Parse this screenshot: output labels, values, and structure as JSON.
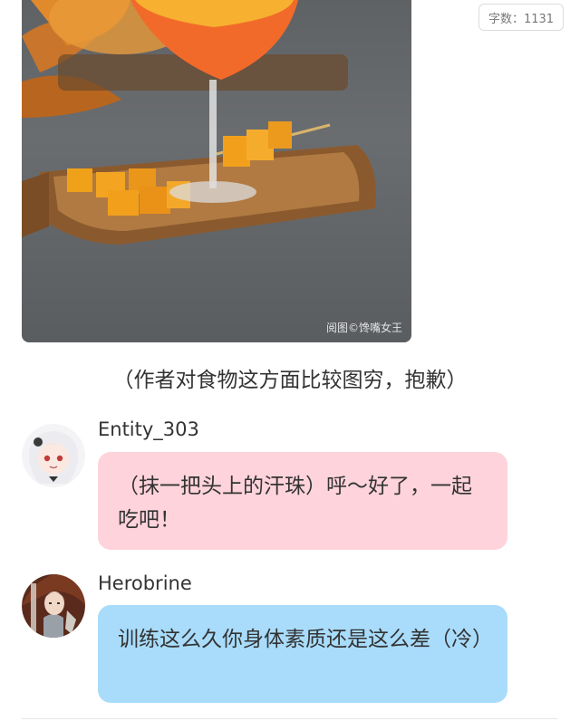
{
  "photo": {
    "watermark": "阅图©馋嘴女王"
  },
  "word_count": {
    "label": "字数：1131"
  },
  "caption": "（作者对食物这方面比较图穷，抱歉）",
  "messages": [
    {
      "author": "Entity_303",
      "text": "（抹一把头上的汗珠）呼～好了，一起吃吧！",
      "bubble_color": "#ffd3dc"
    },
    {
      "author": "Herobrine",
      "text": "训练这么久你身体素质还是这么差（冷）",
      "bubble_color": "#a9dcfb"
    }
  ]
}
